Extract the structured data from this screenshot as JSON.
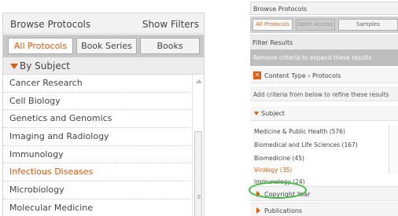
{
  "left_panel": {
    "title": "Browse Protocols",
    "show_filters": "Show Filters",
    "tabs": [
      {
        "label": "All Protocols",
        "active": true
      },
      {
        "label": "Book Series",
        "active": false
      },
      {
        "label": "Books",
        "active": false
      }
    ],
    "subject_header": "By Subject",
    "subjects": [
      {
        "label": "Cancer Research",
        "active": false
      },
      {
        "label": "Cell Biology",
        "active": false
      },
      {
        "label": "Genetics and Genomics",
        "active": false
      },
      {
        "label": "Imaging and Radiology",
        "active": false
      },
      {
        "label": "Immunology",
        "active": false
      },
      {
        "label": "Infectious Diseases",
        "active": true
      },
      {
        "label": "Microbiology",
        "active": false
      },
      {
        "label": "Molecular Medicine",
        "active": false
      }
    ]
  },
  "right_panel": {
    "title": "Browse Protocols",
    "tabs": [
      {
        "label": "All Protocols",
        "state": "active"
      },
      {
        "label": "Open Access",
        "state": "dim"
      },
      {
        "label": "Samples",
        "state": "normal"
      }
    ],
    "filter_results": "Filter Results",
    "remove_hint": "Remove criteria to expand these results",
    "content_type": "Content Type › Protocols",
    "remove_icon": "x-icon",
    "add_criteria": "Add criteria from below to refine these results",
    "subject_header": "Subject",
    "subjects": [
      {
        "label": "Medicine & Public Health (576)",
        "active": false
      },
      {
        "label": "Biomedical and Life Sciences (167)",
        "active": false
      },
      {
        "label": "Biomedicine (45)",
        "active": false
      },
      {
        "label": "Virology (35)",
        "active": true
      },
      {
        "label": "Immunology (24)",
        "active": false
      }
    ],
    "sections": [
      {
        "label": "Copyright Year"
      },
      {
        "label": "Publications"
      }
    ]
  },
  "colors": {
    "accent": "#e8590c",
    "highlight_circle": "#3bbf3b",
    "tab_bar": "#c9c9c9"
  }
}
